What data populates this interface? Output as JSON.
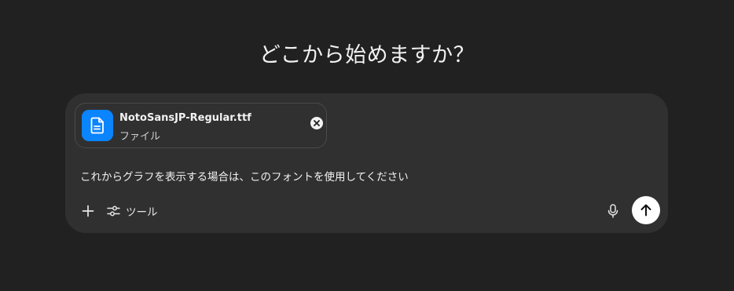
{
  "heading": "どこから始めますか？",
  "attachment": {
    "file_name": "NotoSansJP-Regular.ttf",
    "file_type": "ファイル",
    "icon": "file-icon",
    "accent_color": "#0a84ff"
  },
  "prompt": {
    "text": "これからグラフを表示する場合は、このフォントを使用してください"
  },
  "toolbar": {
    "add_icon": "plus-icon",
    "tools_icon": "sliders-icon",
    "tools_label": "ツール",
    "mic_icon": "microphone-icon",
    "send_icon": "arrow-up-icon"
  }
}
